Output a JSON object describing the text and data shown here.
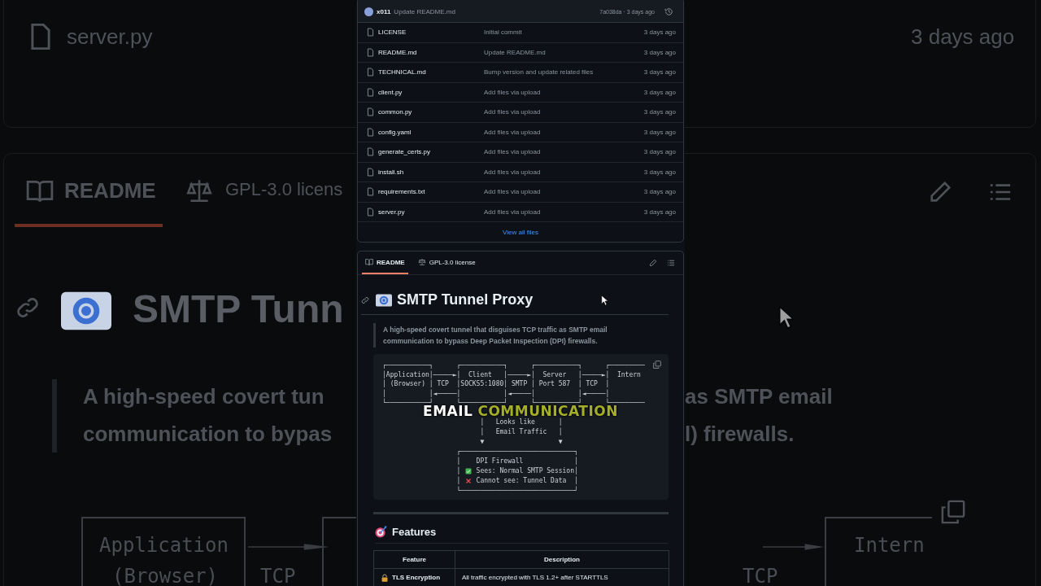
{
  "commit": {
    "author": "x011",
    "message": "Update README.md",
    "meta": "7a038da · 3 days ago"
  },
  "files": [
    {
      "name": "LICENSE",
      "message": "Initial commit",
      "date": "3 days ago"
    },
    {
      "name": "README.md",
      "message": "Update README.md",
      "date": "3 days ago"
    },
    {
      "name": "TECHNICAL.md",
      "message": "Bump version and update related files",
      "date": "3 days ago"
    },
    {
      "name": "client.py",
      "message": "Add files via upload",
      "date": "3 days ago"
    },
    {
      "name": "common.py",
      "message": "Add files via upload",
      "date": "3 days ago"
    },
    {
      "name": "config.yaml",
      "message": "Add files via upload",
      "date": "3 days ago"
    },
    {
      "name": "generate_certs.py",
      "message": "Add files via upload",
      "date": "3 days ago"
    },
    {
      "name": "install.sh",
      "message": "Add files via upload",
      "date": "3 days ago"
    },
    {
      "name": "requirements.txt",
      "message": "Add files via upload",
      "date": "3 days ago"
    },
    {
      "name": "server.py",
      "message": "Add files via upload",
      "date": "3 days ago"
    }
  ],
  "view_all": "View all files",
  "readme_tabs": [
    {
      "label": "README",
      "kind": "book",
      "selected": true
    },
    {
      "label": "GPL-3.0 license",
      "kind": "scale",
      "selected": false
    }
  ],
  "title": "SMTP Tunnel Proxy",
  "summary": "A high-speed covert tunnel that disguises TCP traffic as SMTP email communication to bypass Deep Packet Inspection (DPI) firewalls.",
  "diagram": {
    "upper_lines": [
      "┌───────────┐      ┌───────────┐      ┌───────────┐      ┌─────────",
      "│Application│─────►│  Client   │─────►│  Server   │─────►│  Intern",
      "│ (Browser) │ TCP  │SOCKS5:1080│ SMTP │ Port 587  │ TCP  │",
      "│           │◄─────│           │◄─────│           │◄─────│",
      "└───────────┘      └───────────┘      └───────────┘      └─────────"
    ],
    "lower_lines": [
      [
        {
          "kind": "text",
          "text": "                         │   Looks like      │"
        }
      ],
      [
        {
          "kind": "text",
          "text": "                         │   Email Traffic   │"
        }
      ],
      [
        {
          "kind": "text",
          "text": "                         ▼                   ▼"
        }
      ],
      [
        {
          "kind": "text",
          "text": "                   ┌─────────────────────────────┐"
        }
      ],
      [
        {
          "kind": "text",
          "text": "                   │    DPI Firewall             │"
        }
      ],
      [
        {
          "kind": "text",
          "text": "                   │ "
        },
        {
          "kind": "check"
        },
        {
          "kind": "text",
          "text": " Sees: Normal SMTP Session│"
        }
      ],
      [
        {
          "kind": "text",
          "text": "                   │ "
        },
        {
          "kind": "cross"
        },
        {
          "kind": "text",
          "text": " Cannot see: Tunnel Data  │"
        }
      ],
      [
        {
          "kind": "text",
          "text": "                   └─────────────────────────────┘"
        }
      ]
    ]
  },
  "caption": [
    {
      "text": "EMAIL",
      "highlighted": false
    },
    {
      "text": "COMMUNICATION",
      "highlighted": true
    }
  ],
  "features": {
    "heading": "Features",
    "columns": [
      "Feature",
      "Description"
    ],
    "rows": [
      {
        "feature": "TLS Encryption",
        "description": "All traffic encrypted with TLS 1.2+ after STARTTLS"
      }
    ]
  },
  "backdrop": {
    "file_name": "server.py",
    "date": "3 days ago",
    "readme_tab": "README",
    "license_tab": "GPL-3.0 licens",
    "heading": "SMTP Tunn",
    "quote_left": [
      "A high-speed covert tun",
      "communication to bypas"
    ],
    "quote_right": [
      "as SMTP email",
      "l) firewalls."
    ],
    "diagram_left": [
      "Application",
      "(Browser)",
      "TCP"
    ],
    "diagram_right": [
      "Intern",
      "TCP"
    ]
  }
}
